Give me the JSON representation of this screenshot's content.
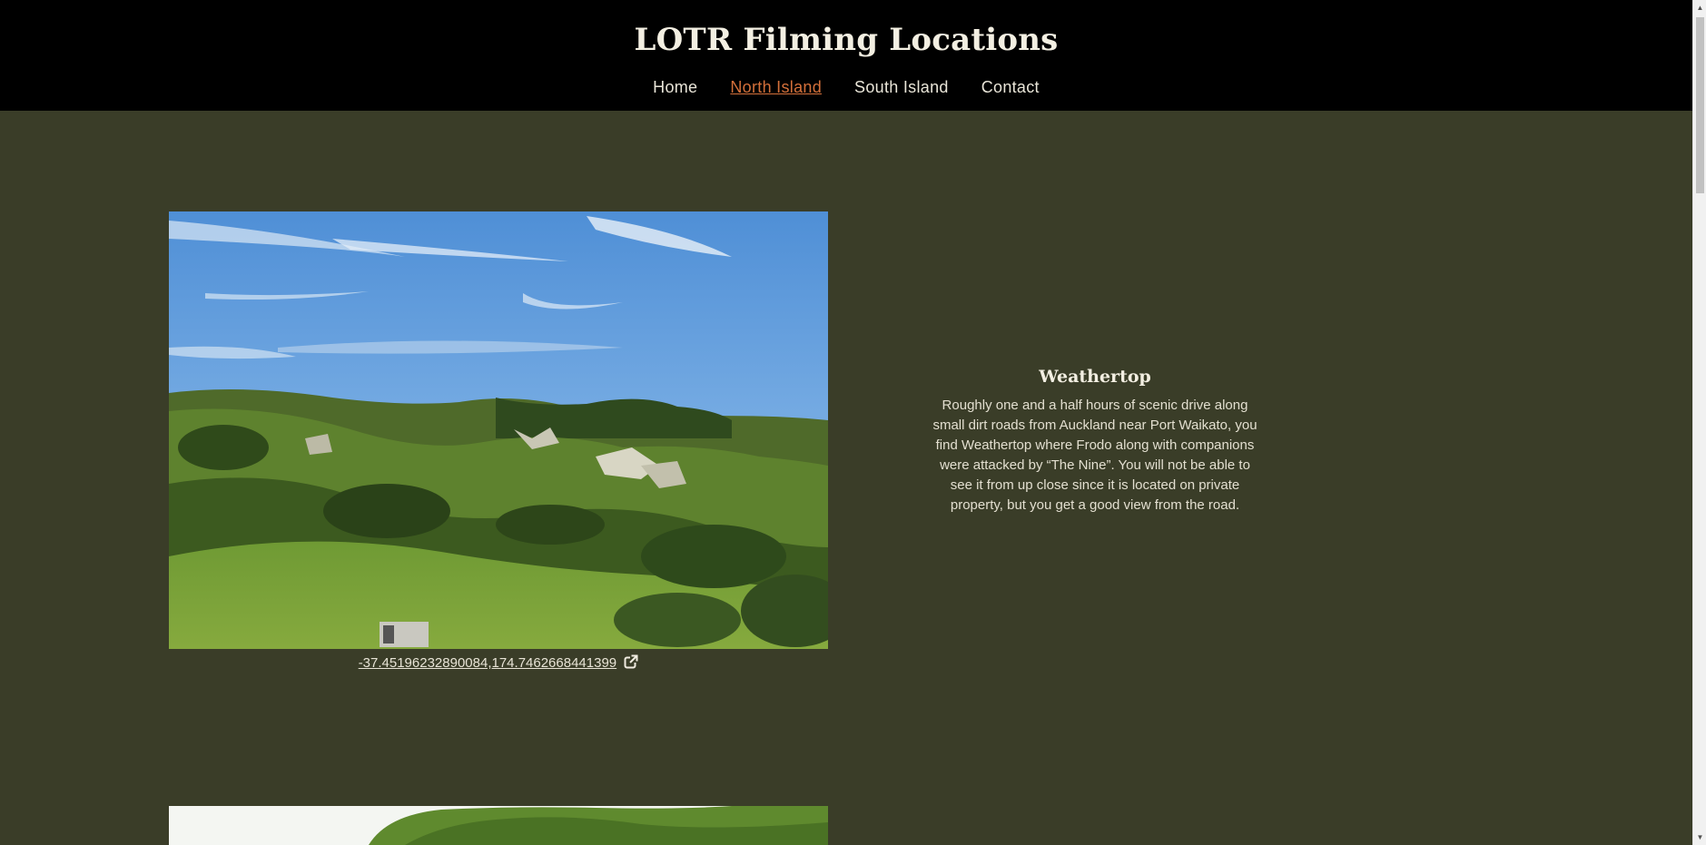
{
  "header": {
    "title": "LOTR Filming Locations",
    "nav": [
      {
        "label": "Home"
      },
      {
        "label": "North Island"
      },
      {
        "label": "South Island"
      },
      {
        "label": "Contact"
      }
    ]
  },
  "location": {
    "title": "Weathertop",
    "description": "Roughly one and a half hours of scenic drive along small dirt roads from Auckland near Port Waikato, you find Weathertop where Frodo along with companions were attacked by “The Nine”. You will not be able to see it from up close since it is located on private property, but you get a good view from the road.",
    "coordinates": "-37.45196232890084,174.7462668441399"
  },
  "colors": {
    "background": "#3a3d28",
    "header": "#000000",
    "accent": "#d4703a"
  }
}
